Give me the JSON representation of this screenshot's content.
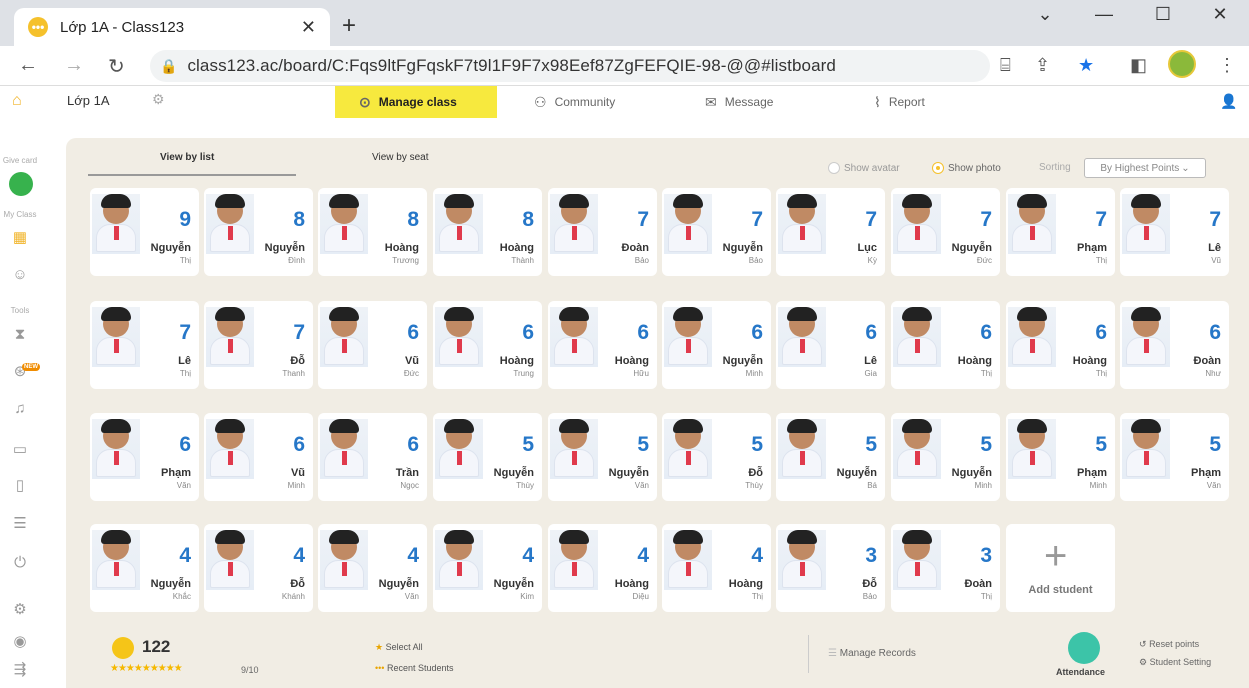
{
  "browser": {
    "tab_title": "Lớp 1A - Class123",
    "favicon_glyph": "•••",
    "url": "class123.ac/board/C:Fqs9ltFgFqskF7t9l1F9F7x98Eef87ZgFEFQIE-98-@@#listboard"
  },
  "header": {
    "class_name": "Lớp 1A",
    "menu": [
      "Manage class",
      "Community",
      "Message",
      "Report"
    ]
  },
  "sidebar": {
    "labels": [
      "Give card",
      "My Class",
      "Tools"
    ],
    "new_badge": "NEW"
  },
  "view_tabs": [
    "View by list",
    "View by seat"
  ],
  "options": {
    "show_avatar": "Show avatar",
    "show_photo": "Show photo",
    "sorting_label": "Sorting",
    "sort_value": "By Highest Points"
  },
  "students": [
    {
      "points": "9",
      "name": "Nguyễn",
      "sub": "Thị"
    },
    {
      "points": "8",
      "name": "Nguyễn",
      "sub": "Đình"
    },
    {
      "points": "8",
      "name": "Hoàng",
      "sub": "Trương"
    },
    {
      "points": "8",
      "name": "Hoàng",
      "sub": "Thành"
    },
    {
      "points": "7",
      "name": "Đoàn",
      "sub": "Bảo"
    },
    {
      "points": "7",
      "name": "Nguyễn",
      "sub": "Bảo"
    },
    {
      "points": "7",
      "name": "Lục",
      "sub": "Kỳ"
    },
    {
      "points": "7",
      "name": "Nguyễn",
      "sub": "Đức"
    },
    {
      "points": "7",
      "name": "Phạm",
      "sub": "Thị"
    },
    {
      "points": "7",
      "name": "Lê",
      "sub": "Vũ"
    },
    {
      "points": "7",
      "name": "Lê",
      "sub": "Thị"
    },
    {
      "points": "7",
      "name": "Đỗ",
      "sub": "Thanh"
    },
    {
      "points": "6",
      "name": "Vũ",
      "sub": "Đức"
    },
    {
      "points": "6",
      "name": "Hoàng",
      "sub": "Trung"
    },
    {
      "points": "6",
      "name": "Hoàng",
      "sub": "Hữu"
    },
    {
      "points": "6",
      "name": "Nguyễn",
      "sub": "Minh"
    },
    {
      "points": "6",
      "name": "Lê",
      "sub": "Gia"
    },
    {
      "points": "6",
      "name": "Hoàng",
      "sub": "Thị"
    },
    {
      "points": "6",
      "name": "Hoàng",
      "sub": "Thị"
    },
    {
      "points": "6",
      "name": "Đoàn",
      "sub": "Như"
    },
    {
      "points": "6",
      "name": "Phạm",
      "sub": "Văn"
    },
    {
      "points": "6",
      "name": "Vũ",
      "sub": "Minh"
    },
    {
      "points": "6",
      "name": "Trần",
      "sub": "Ngọc"
    },
    {
      "points": "5",
      "name": "Nguyễn",
      "sub": "Thùy"
    },
    {
      "points": "5",
      "name": "Nguyễn",
      "sub": "Văn"
    },
    {
      "points": "5",
      "name": "Đỗ",
      "sub": "Thùy"
    },
    {
      "points": "5",
      "name": "Nguyễn",
      "sub": "Bá"
    },
    {
      "points": "5",
      "name": "Nguyễn",
      "sub": "Minh"
    },
    {
      "points": "5",
      "name": "Phạm",
      "sub": "Minh"
    },
    {
      "points": "5",
      "name": "Phạm",
      "sub": "Văn"
    },
    {
      "points": "4",
      "name": "Nguyễn",
      "sub": "Khắc"
    },
    {
      "points": "4",
      "name": "Đỗ",
      "sub": "Khánh"
    },
    {
      "points": "4",
      "name": "Nguyễn",
      "sub": "Văn"
    },
    {
      "points": "4",
      "name": "Nguyễn",
      "sub": "Kim"
    },
    {
      "points": "4",
      "name": "Hoàng",
      "sub": "Diệu"
    },
    {
      "points": "4",
      "name": "Hoàng",
      "sub": "Thị"
    },
    {
      "points": "3",
      "name": "Đỗ",
      "sub": "Bảo"
    },
    {
      "points": "3",
      "name": "Đoàn",
      "sub": "Thị"
    }
  ],
  "add_student": "Add student",
  "footer": {
    "total_points": "122",
    "stars": "★★★★★★★★★",
    "ratio": "9/10",
    "select_all": "Select All",
    "recent_students": "Recent Students",
    "manage_records": "Manage Records",
    "attendance": "Attendance",
    "reset_points": "Reset points",
    "student_setting": "Student Setting"
  },
  "colors": {
    "accent": "#f7e93e",
    "points": "#2677c8",
    "panel": "#f1ede4"
  }
}
